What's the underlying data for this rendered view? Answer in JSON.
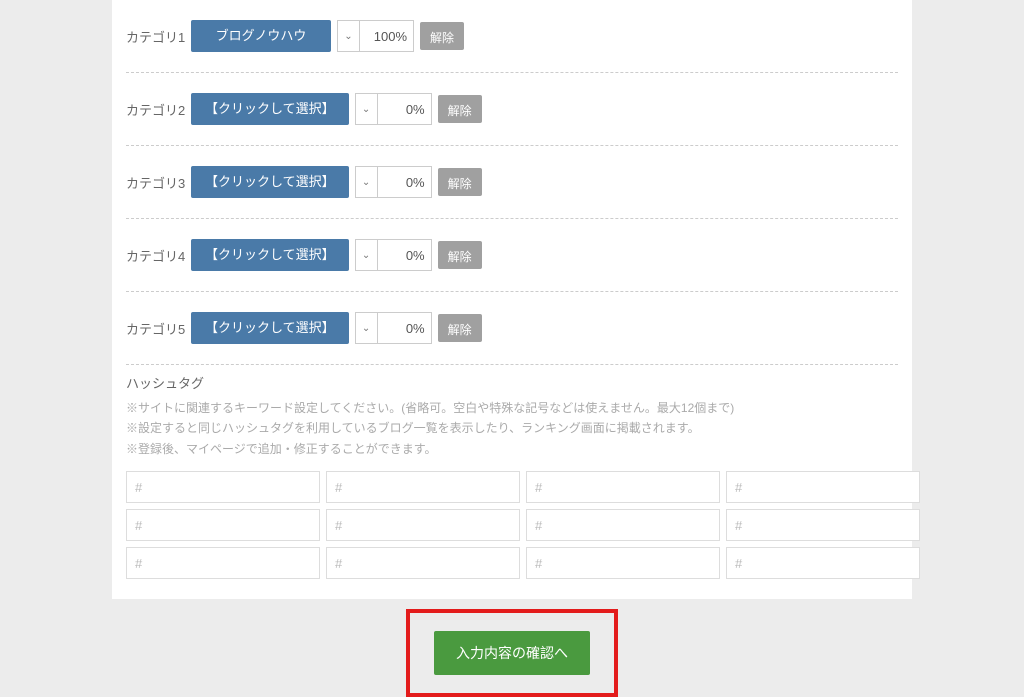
{
  "categories": [
    {
      "label": "カテゴリ1",
      "button": "ブログノウハウ",
      "percent": "100%",
      "release": "解除"
    },
    {
      "label": "カテゴリ2",
      "button": "【クリックして選択】",
      "percent": "0%",
      "release": "解除"
    },
    {
      "label": "カテゴリ3",
      "button": "【クリックして選択】",
      "percent": "0%",
      "release": "解除"
    },
    {
      "label": "カテゴリ4",
      "button": "【クリックして選択】",
      "percent": "0%",
      "release": "解除"
    },
    {
      "label": "カテゴリ5",
      "button": "【クリックして選択】",
      "percent": "0%",
      "release": "解除"
    }
  ],
  "hashtag": {
    "title": "ハッシュタグ",
    "note1": "※サイトに関連するキーワード設定してください。(省略可。空白や特殊な記号などは使えません。最大12個まで)",
    "note2": "※設定すると同じハッシュタグを利用しているブログ一覧を表示したり、ランキング画面に掲載されます。",
    "note3": "※登録後、マイページで追加・修正することができます。",
    "placeholder": "#"
  },
  "submit": {
    "label": "入力内容の確認へ"
  }
}
